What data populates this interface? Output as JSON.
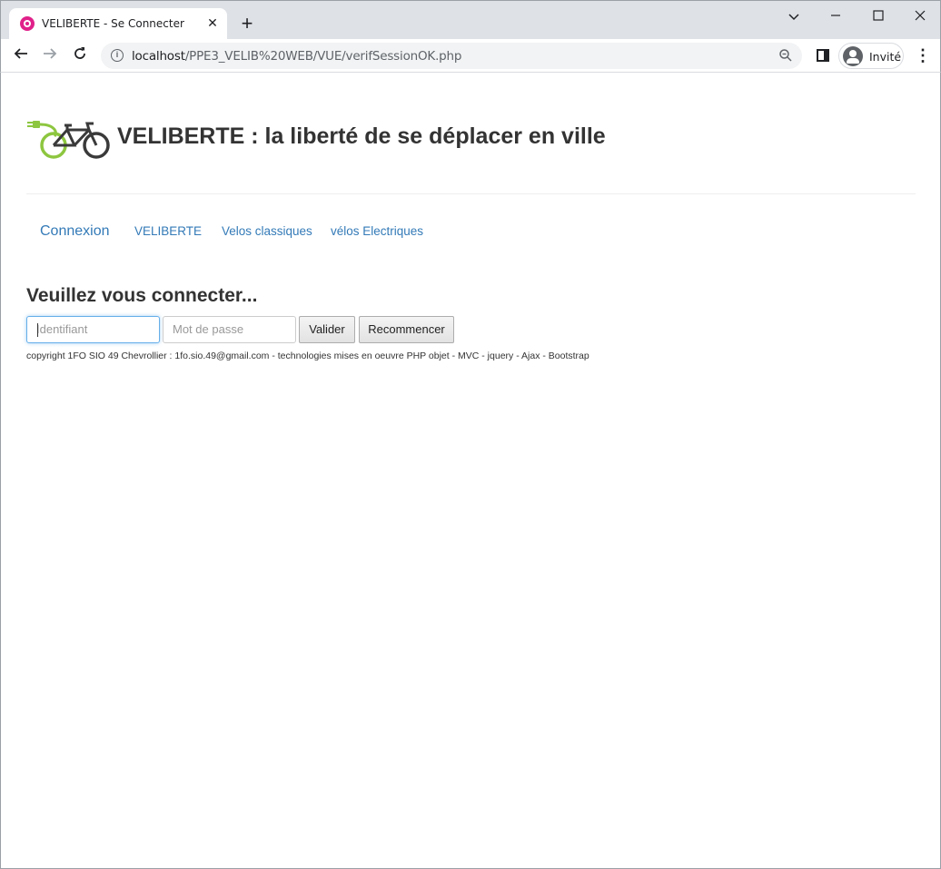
{
  "browser": {
    "tab_title": "VELIBERTE - Se Connecter",
    "new_tab_label": "+",
    "url_host": "localhost",
    "url_path": "/PPE3_VELIB%20WEB/VUE/verifSessionOK.php",
    "profile_label": "Invité"
  },
  "site": {
    "title": "VELIBERTE : la liberté de se déplacer en ville",
    "logo_colors": {
      "plug": "#8dc63f",
      "bike": "#3a3a3a"
    }
  },
  "nav": {
    "items": [
      {
        "label": "Connexion"
      },
      {
        "label": "VELIBERTE"
      },
      {
        "label": "Velos classiques"
      },
      {
        "label": "vélos Electriques"
      }
    ]
  },
  "login": {
    "heading": "Veuillez vous connecter...",
    "identifiant_placeholder": "Identifiant",
    "password_placeholder": "Mot de passe",
    "submit_label": "Valider",
    "reset_label": "Recommencer"
  },
  "footer": {
    "text": "copyright 1FO SIO 49 Chevrollier : 1fo.sio.49@gmail.com - technologies mises en oeuvre PHP objet - MVC - jquery - Ajax - Bootstrap"
  },
  "colors": {
    "link": "#337ab7",
    "focus_border": "#66afe9",
    "favicon": "#e0218a"
  }
}
